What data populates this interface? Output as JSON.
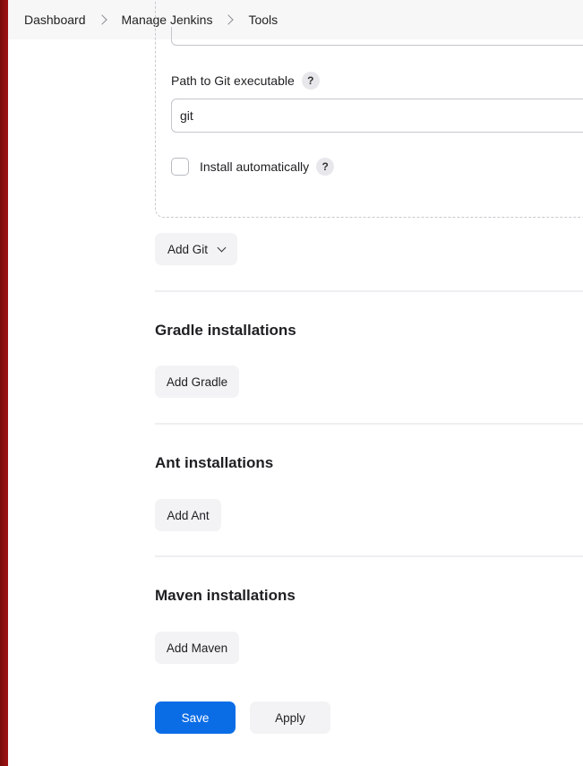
{
  "breadcrumb": {
    "items": [
      "Dashboard",
      "Manage Jenkins",
      "Tools"
    ]
  },
  "git": {
    "path_label": "Path to Git executable",
    "path_value": "git",
    "install_auto_label": "Install automatically",
    "help_symbol": "?",
    "add_button_label": "Add Git"
  },
  "gradle": {
    "title": "Gradle installations",
    "add_button_label": "Add Gradle"
  },
  "ant": {
    "title": "Ant installations",
    "add_button_label": "Add Ant"
  },
  "maven": {
    "title": "Maven installations",
    "add_button_label": "Add Maven"
  },
  "actions": {
    "save_label": "Save",
    "apply_label": "Apply"
  },
  "colors": {
    "primary": "#0b6de6",
    "sidebar_edge": "#8b0f0f"
  }
}
